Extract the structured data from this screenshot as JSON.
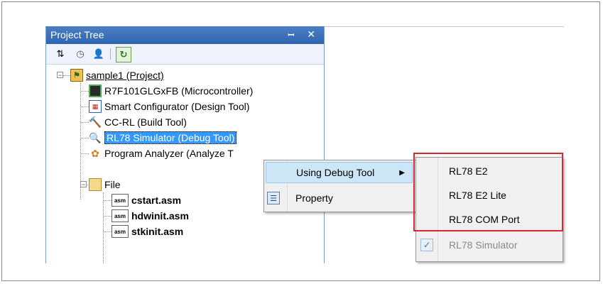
{
  "panel": {
    "title": "Project Tree",
    "pin_glyph": "ꟷ",
    "close_glyph": "✕"
  },
  "toolbar": {
    "sort_glyph": "⇅",
    "clock_glyph": "◷",
    "person_glyph": "👤",
    "refresh_glyph": "↻"
  },
  "tree": {
    "project": "sample1 (Project)",
    "microcontroller": "R7F101GLGxFB (Microcontroller)",
    "smart_configurator": "Smart Configurator (Design Tool)",
    "build_tool": "CC-RL (Build Tool)",
    "debug_tool": "RL78 Simulator (Debug Tool)",
    "analyzer": "Program Analyzer (Analyze T",
    "file_folder": "File",
    "files": [
      "cstart.asm",
      "hdwinit.asm",
      "stkinit.asm"
    ]
  },
  "context_menu": {
    "using_debug_tool": "Using Debug Tool",
    "arrow": "▶",
    "property": "Property"
  },
  "submenu": {
    "items": [
      "RL78 E2",
      "RL78 E2 Lite",
      "RL78 COM Port",
      "RL78 Simulator"
    ],
    "check_glyph": "✓"
  },
  "icon_text": {
    "asm": "asm"
  },
  "colors": {
    "title_bar": "#2f64b0",
    "selection": "#3399ff",
    "highlight_box": "#d8272e",
    "menu_hover": "#cde6f7"
  }
}
